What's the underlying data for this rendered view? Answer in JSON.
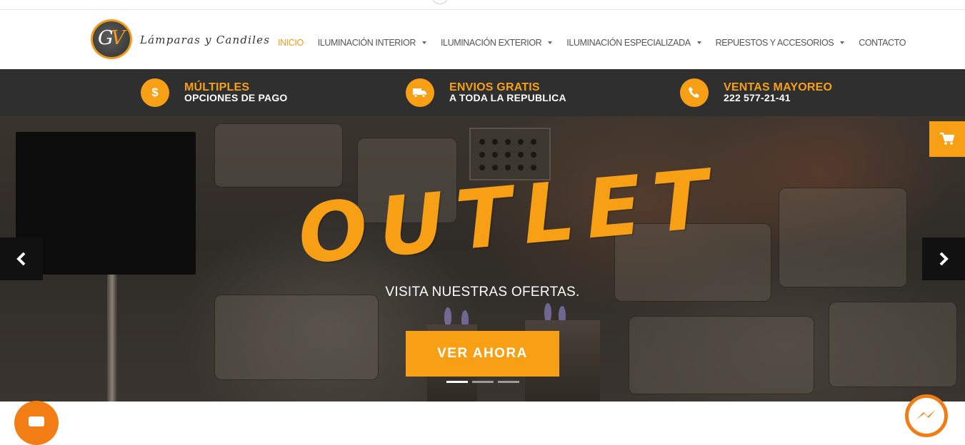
{
  "brand": {
    "logo_letters": "GV",
    "name": "Lámparas y Candiles"
  },
  "nav": {
    "items": [
      {
        "label": "INICIO",
        "active": true,
        "dropdown": false
      },
      {
        "label": "ILUMINACIÓN INTERIOR",
        "active": false,
        "dropdown": true
      },
      {
        "label": "ILUMINACIÓN EXTERIOR",
        "active": false,
        "dropdown": true
      },
      {
        "label": "ILUMINACIÓN ESPECIALIZADA",
        "active": false,
        "dropdown": true
      },
      {
        "label": "REPUESTOS Y ACCESORIOS",
        "active": false,
        "dropdown": true
      },
      {
        "label": "CONTACTO",
        "active": false,
        "dropdown": false
      }
    ]
  },
  "infobar": {
    "payment": {
      "icon": "dollar-icon",
      "symbol": "$",
      "title": "MÚLTIPLES",
      "subtitle": "OPCIONES DE PAGO"
    },
    "shipping": {
      "icon": "truck-icon",
      "title": "ENVIOS GRATIS",
      "subtitle": "A TODA LA REPUBLICA"
    },
    "wholesale": {
      "icon": "phone-icon",
      "title": "VENTAS MAYOREO",
      "subtitle": "222 577-21-41"
    }
  },
  "hero": {
    "headline": "OUTLET",
    "subtitle": "VISITA NUESTRAS OFERTAS.",
    "cta_label": "VER AHORA",
    "slide_count": 3,
    "active_slide": 1
  },
  "colors": {
    "accent": "#f7a016",
    "infobar_bg": "#2f2f2f",
    "nav_active": "#f29a1c",
    "chat": "#f27d14"
  },
  "widgets": {
    "cart_icon": "cart-icon",
    "prev_icon": "chevron-left-icon",
    "next_icon": "chevron-right-icon",
    "chat_icon": "chat-icon",
    "messenger_icon": "messenger-icon"
  }
}
